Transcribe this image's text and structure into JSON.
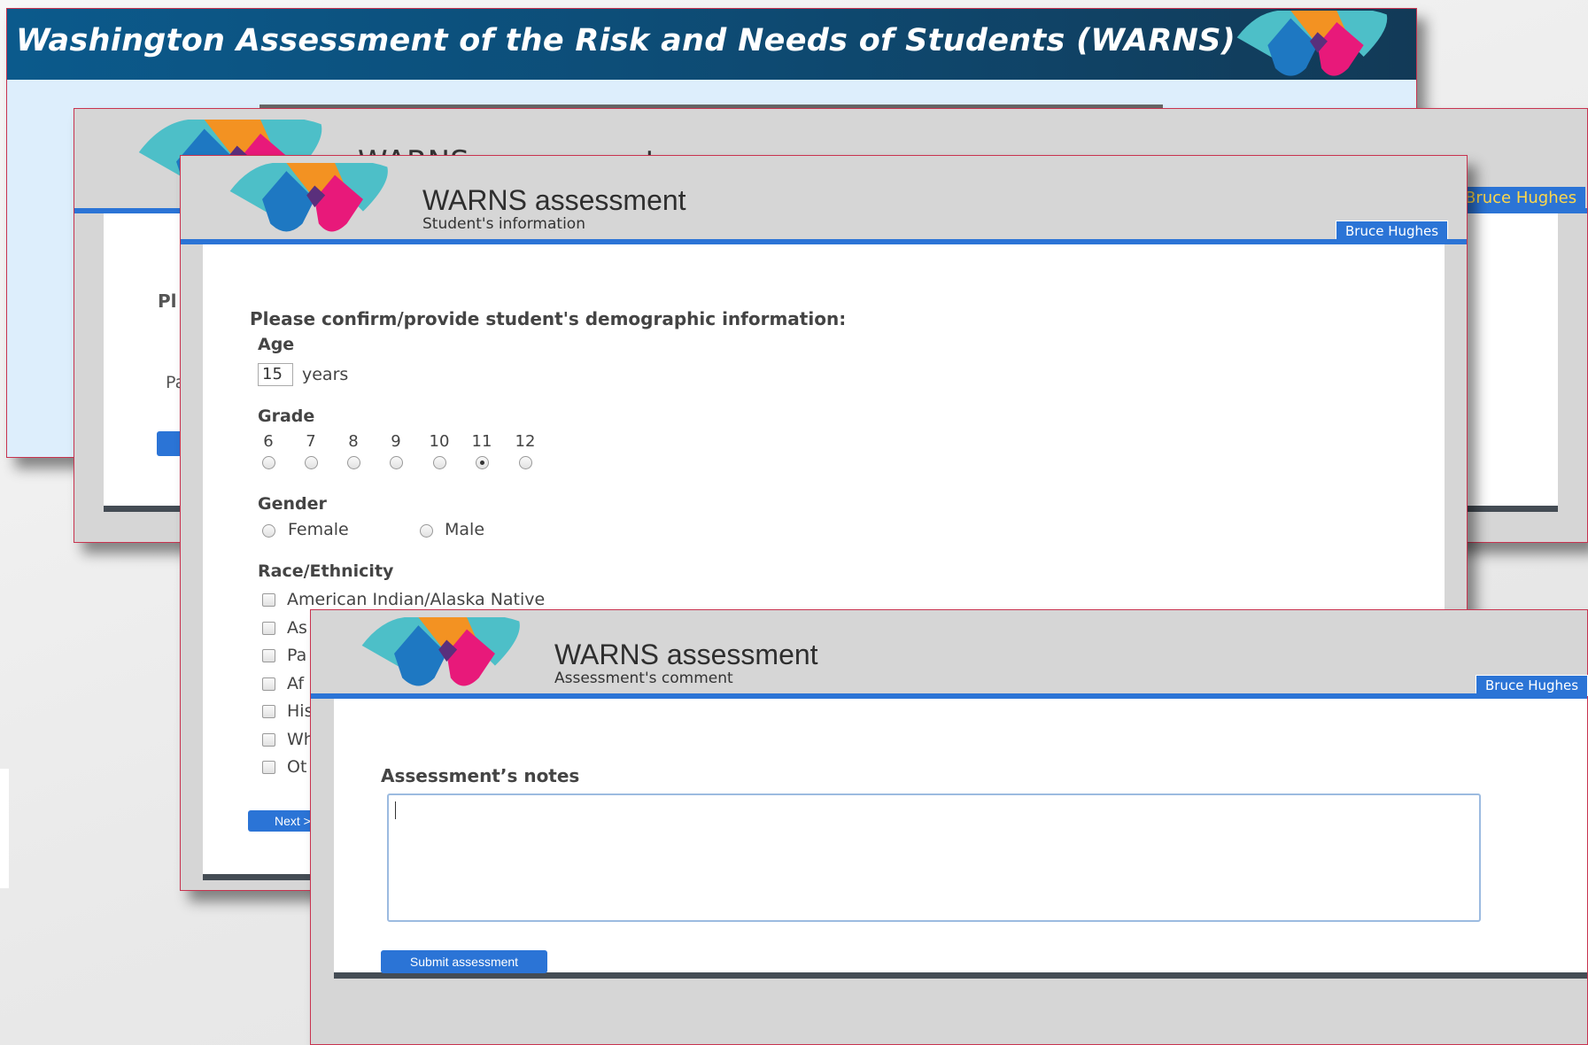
{
  "background_window": {
    "title": "Washington Assessment of the Risk and Needs of Students (WARNS)"
  },
  "middle_window": {
    "title_partial": "WARNS assessment",
    "partial_label_1": "Pl",
    "partial_label_2": "Pa",
    "user": "Bruce Hughes"
  },
  "student_window": {
    "app_title": "WARNS assessment",
    "subtitle": "Student's information",
    "user": "Bruce Hughes",
    "prompt": "Please confirm/provide student's demographic information:",
    "age": {
      "label": "Age",
      "value": "15",
      "unit": "years"
    },
    "grade": {
      "label": "Grade",
      "options": [
        "6",
        "7",
        "8",
        "9",
        "10",
        "11",
        "12"
      ],
      "selected": "11"
    },
    "gender": {
      "label": "Gender",
      "options": [
        "Female",
        "Male"
      ],
      "selected": null
    },
    "race": {
      "label": "Race/Ethnicity",
      "options": [
        "American Indian/Alaska Native",
        "As",
        "Pa",
        "Af",
        "His",
        "Wh",
        "Ot"
      ]
    },
    "next_button": "Next >"
  },
  "comment_window": {
    "app_title": "WARNS assessment",
    "subtitle": "Assessment's comment",
    "user": "Bruce Hughes",
    "notes_label": "Assessment’s notes",
    "notes_value": "",
    "submit_button": "Submit assessment"
  },
  "colors": {
    "accent_blue": "#2b74d6",
    "logo_teal": "#4dbfc8",
    "logo_orange": "#f39222",
    "logo_blue": "#1e78c2",
    "logo_pink": "#e8197a",
    "title_bar": "#0b5a8c"
  }
}
